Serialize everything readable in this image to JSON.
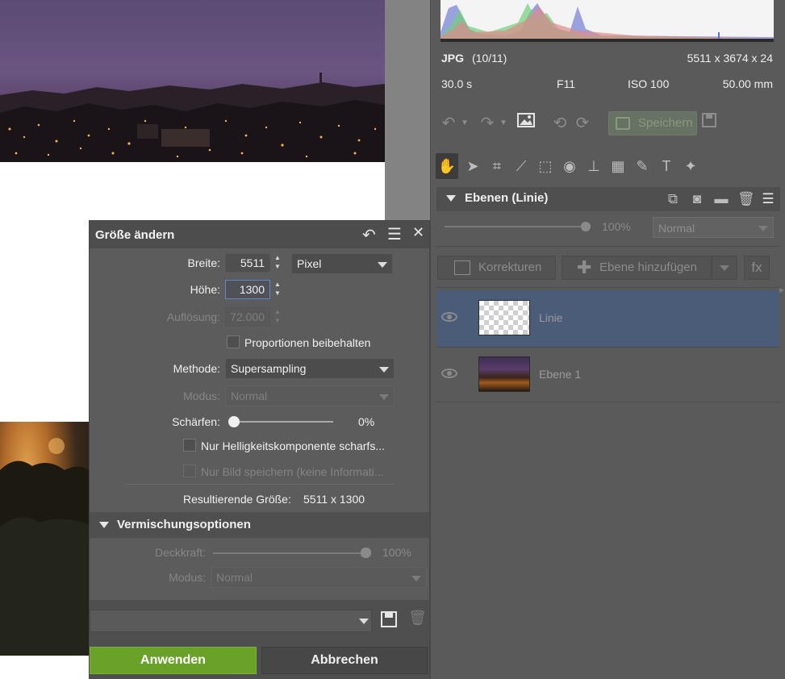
{
  "info": {
    "format": "JPG",
    "index": "(10/11)",
    "dimensions": "5511 x 3674 x 24",
    "exposure": "30.0 s",
    "aperture": "F11",
    "iso": "ISO 100",
    "focal_length": "50.00 mm"
  },
  "toolbar": {
    "save_label": "Speichern"
  },
  "layers": {
    "header_title": "Ebenen (Linie)",
    "opacity_value": "100%",
    "blend_mode": "Normal",
    "corrections_label": "Korrekturen",
    "add_layer_label": "Ebene hinzufügen",
    "fx_label": "fx",
    "items": [
      {
        "name": "Linie",
        "selected": true
      },
      {
        "name": "Ebene 1",
        "selected": false
      }
    ]
  },
  "dialog": {
    "title": "Größe ändern",
    "width_label": "Breite:",
    "width_value": "5511",
    "unit": "Pixel",
    "height_label": "Höhe:",
    "height_value": "1300",
    "resolution_label": "Auflösung:",
    "resolution_value": "72.000",
    "keep_proportions": "Proportionen beibehalten",
    "method_label": "Methode:",
    "method_value": "Supersampling",
    "mode_label": "Modus:",
    "mode_value": "Normal",
    "sharpen_label": "Schärfen:",
    "sharpen_value": "0%",
    "sharpen_level": 0,
    "luminance_only": "Nur Helligkeitskomponente scharfs...",
    "save_image_only": "Nur Bild speichern (keine Informati...",
    "result_label": "Resultierende Größe:",
    "result_value": "5511 x 1300",
    "blend_title": "Vermischungsoptionen",
    "opacity_label": "Deckkraft:",
    "opacity_value": "100%",
    "blend_mode_label": "Modus:",
    "blend_mode_value": "Normal",
    "apply_label": "Anwenden",
    "cancel_label": "Abbrechen"
  },
  "colors": {
    "accent_green": "#6aa128",
    "selection_blue": "#4b5c79",
    "panel_bg": "#5a5a5a"
  }
}
